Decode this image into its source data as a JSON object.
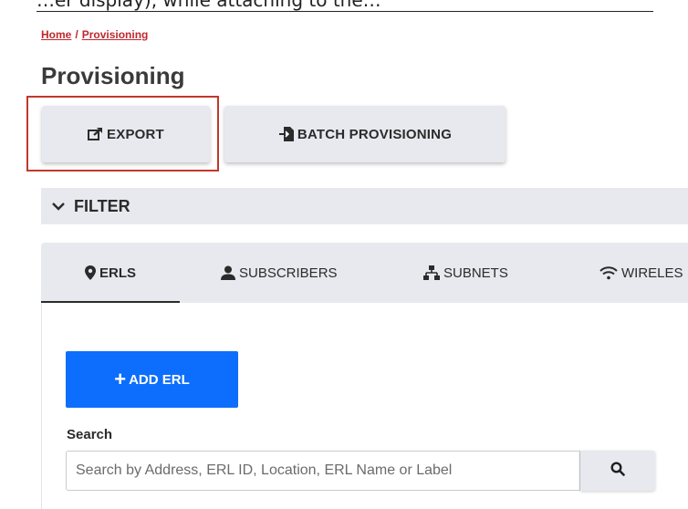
{
  "top_cutoff_text": "…er display), while attaching to the…",
  "breadcrumb": {
    "home": "Home",
    "separator": "/",
    "current": "Provisioning"
  },
  "page_title": "Provisioning",
  "actions": {
    "export_label": "EXPORT",
    "batch_label": "BATCH PROVISIONING"
  },
  "filter": {
    "label": "FILTER"
  },
  "tabs": [
    {
      "label": "ERLS",
      "icon": "map-pin-icon",
      "active": true
    },
    {
      "label": "SUBSCRIBERS",
      "icon": "user-icon",
      "active": false
    },
    {
      "label": "SUBNETS",
      "icon": "network-icon",
      "active": false
    },
    {
      "label": "WIRELES",
      "icon": "wifi-icon",
      "active": false
    }
  ],
  "add_button": {
    "label": "ADD ERL"
  },
  "search": {
    "label": "Search",
    "placeholder": "Search by Address, ERL ID, Location, ERL Name or Label",
    "value": ""
  },
  "colors": {
    "accent_blue": "#0d6efd",
    "breadcrumb_red": "#c0272d",
    "highlight_border": "#c0392b",
    "button_gray": "#e7e9ee"
  }
}
